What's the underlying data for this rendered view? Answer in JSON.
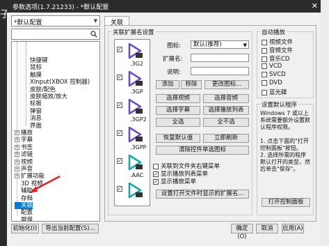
{
  "window": {
    "title": "参数选项(1.7.21233) - *默认配置"
  },
  "outer": {
    "left_glyph": "子"
  },
  "tabs": [
    {
      "label": "关联"
    }
  ],
  "profile_combo": {
    "value": "*默认配置"
  },
  "tree": {
    "items": [
      {
        "label": "快捷键",
        "level": 2,
        "expander": ""
      },
      {
        "label": "鼠标",
        "level": 2,
        "expander": ""
      },
      {
        "label": "触摸",
        "level": 2,
        "expander": ""
      },
      {
        "label": "XInput(XBOX 控制器)",
        "level": 2,
        "expander": ""
      },
      {
        "label": "皮肤/配色",
        "level": 2,
        "expander": ""
      },
      {
        "label": "皮肤缩放/放大",
        "level": 2,
        "expander": ""
      },
      {
        "label": "标板",
        "level": 2,
        "expander": ""
      },
      {
        "label": "弹窗",
        "level": 2,
        "expander": ""
      },
      {
        "label": "消息",
        "level": 2,
        "expander": ""
      },
      {
        "label": "界面",
        "level": 2,
        "expander": ""
      },
      {
        "label": "播放",
        "level": 1,
        "expander": "+"
      },
      {
        "label": "字幕",
        "level": 1,
        "expander": "+"
      },
      {
        "label": "书签",
        "level": 1,
        "expander": "+"
      },
      {
        "label": "滤镜",
        "level": 1,
        "expander": "+"
      },
      {
        "label": "视频",
        "level": 1,
        "expander": "+"
      },
      {
        "label": "声音",
        "level": 1,
        "expander": "+"
      },
      {
        "label": "扩展功能",
        "level": 1,
        "expander": "+"
      },
      {
        "label": "3D 视频",
        "level": 1,
        "expander": ""
      },
      {
        "label": "辅助",
        "level": 1,
        "expander": ""
      },
      {
        "label": "存档",
        "level": 1,
        "expander": ""
      },
      {
        "label": "关联",
        "level": 1,
        "expander": "",
        "selected": true
      },
      {
        "label": "配置",
        "level": 1,
        "expander": ""
      },
      {
        "label": "屏保",
        "level": 1,
        "expander": ""
      }
    ]
  },
  "assoc": {
    "group_title": "关联扩展名设置",
    "files": [
      {
        "ext": ".3G2",
        "checked": true,
        "color": "#6a4fc9"
      },
      {
        "ext": ".3GP",
        "checked": true,
        "color": "#6a4fc9"
      },
      {
        "ext": ".3GP2",
        "checked": true,
        "color": "#6a4fc9"
      },
      {
        "ext": ".3GPP",
        "checked": true,
        "color": "#6a4fc9"
      },
      {
        "ext": ".AAC",
        "checked": true,
        "color": "#1ea5a5"
      },
      {
        "ext": "",
        "checked": true,
        "color": "#1ea5a5"
      }
    ],
    "icon_label": "图标:",
    "icon_value": "默认(推荐)",
    "ext_label": "扩展名:",
    "ext_value": "",
    "desc_label": "说明:",
    "desc_value": "",
    "btn_add": "添加",
    "btn_remove": "移除",
    "btn_change_icon": "更改图标...",
    "btn_select_video": "选择视频",
    "btn_select_audio": "选择音频",
    "btn_select_subtitle": "选择字幕",
    "btn_select_playlist": "选择播放列表",
    "btn_select_all": "全选",
    "btn_select_none": "全不选",
    "btn_restore": "恢复默认值",
    "btn_refresh": "立即刷新",
    "btn_clean": "清除控件单选图标",
    "cb_context": "关联到文件夹右键菜单",
    "cb_show_playlist": "显示播放列表菜单",
    "cb_show_play": "显示播放菜单",
    "btn_set_open_icon": "设置打开文件时显示的扩展名..."
  },
  "autoplay": {
    "title": "自动播放",
    "items": [
      {
        "label": "视频文件",
        "checked": false
      },
      {
        "label": "音频文件",
        "checked": false
      },
      {
        "label": "音乐CD",
        "checked": false
      },
      {
        "label": "VCD",
        "checked": false
      },
      {
        "label": "SVCD",
        "checked": false
      },
      {
        "label": "DVD",
        "checked": false
      },
      {
        "label": "蓝光碟",
        "checked": false
      }
    ]
  },
  "default_program": {
    "title": "设置默认程序",
    "note": "Windows 7 或以上系统需要额外设置默认程序权限。\n\n1. 点击下面的\"打开控制面板\"按钮。\n2. 选择所需的程序默认打开的类型，然后单击\"保存\"。",
    "button": "打开控制面板"
  },
  "footer": {
    "init": "初始化(I)",
    "export": "导出当前配置(S)...",
    "ok": "确定(O)",
    "cancel": "取消",
    "apply": "应用(A)"
  }
}
